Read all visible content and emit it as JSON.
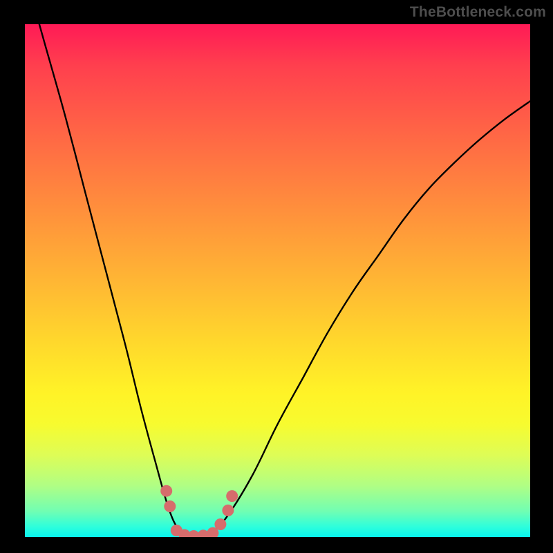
{
  "watermark": "TheBottleneck.com",
  "chart_data": {
    "type": "line",
    "title": "",
    "xlabel": "",
    "ylabel": "",
    "xlim": [
      0,
      100
    ],
    "ylim": [
      0,
      100
    ],
    "series": [
      {
        "name": "curve",
        "x": [
          0,
          4,
          8,
          12,
          16,
          20,
          23,
          26,
          28,
          29.5,
          31,
          33,
          35,
          37,
          40,
          45,
          50,
          55,
          60,
          65,
          70,
          75,
          80,
          85,
          90,
          95,
          100
        ],
        "values": [
          110,
          96,
          82,
          67,
          52,
          37,
          25,
          14,
          7,
          3,
          1,
          0,
          0,
          1,
          4,
          12,
          22,
          31,
          40,
          48,
          55,
          62,
          68,
          73,
          77.5,
          81.5,
          85
        ]
      }
    ],
    "markers": [
      {
        "x": 28.0,
        "y": 9.0
      },
      {
        "x": 28.7,
        "y": 6.0
      },
      {
        "x": 30.0,
        "y": 1.3
      },
      {
        "x": 31.6,
        "y": 0.4
      },
      {
        "x": 33.4,
        "y": 0.2
      },
      {
        "x": 35.3,
        "y": 0.3
      },
      {
        "x": 37.2,
        "y": 0.8
      },
      {
        "x": 38.7,
        "y": 2.5
      },
      {
        "x": 40.2,
        "y": 5.2
      },
      {
        "x": 41.0,
        "y": 8.0
      }
    ],
    "colors": {
      "curve": "#000000",
      "markers": "#d66c6c",
      "gradient_top": "#ff1a56",
      "gradient_bottom": "#08f4ed"
    }
  }
}
